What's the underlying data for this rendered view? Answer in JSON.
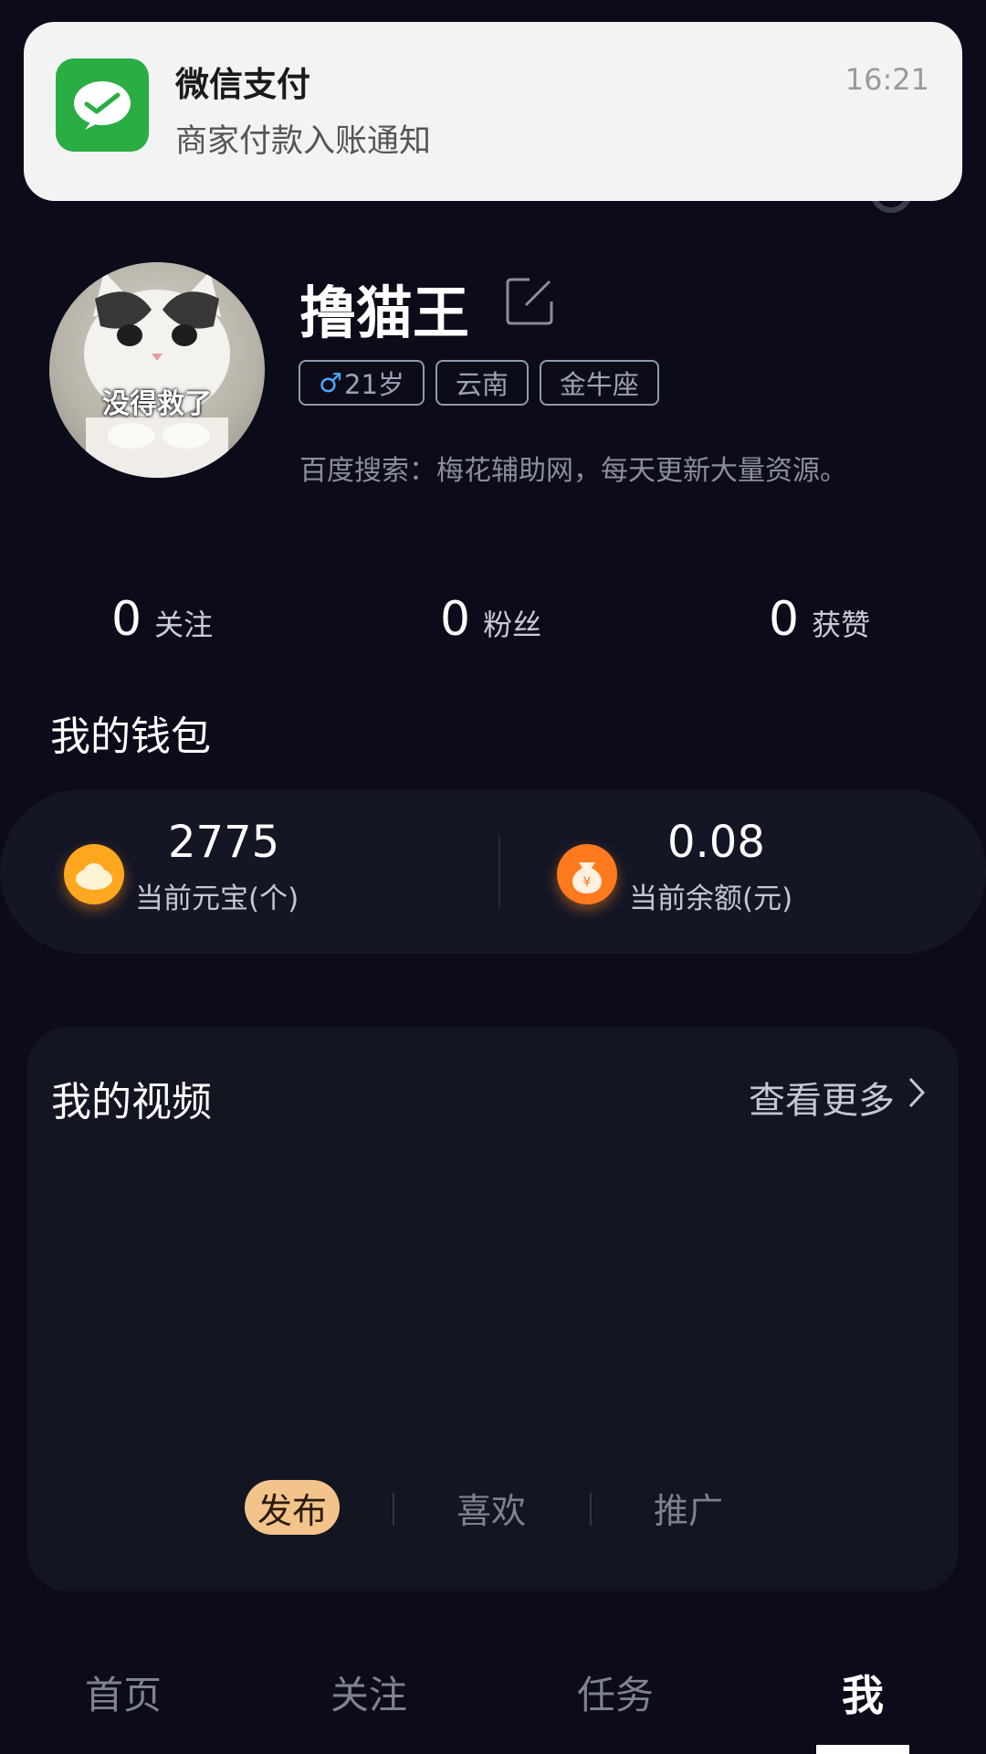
{
  "notification": {
    "app_name": "微信支付",
    "message": "商家付款入账通知",
    "time": "16:21",
    "icon": "wechat-pay-icon"
  },
  "profile": {
    "avatar_caption": "没得救了",
    "username": "撸猫王",
    "tags": {
      "gender_symbol": "♂",
      "age": "21岁",
      "region": "云南",
      "zodiac": "金牛座"
    },
    "signature": "百度搜索：梅花辅助网，每天更新大量资源。"
  },
  "stats": {
    "following": {
      "value": "0",
      "label": "关注"
    },
    "fans": {
      "value": "0",
      "label": "粉丝"
    },
    "likes": {
      "value": "0",
      "label": "获赞"
    }
  },
  "wallet": {
    "title": "我的钱包",
    "yuanbao": {
      "value": "2775",
      "label": "当前元宝(个)"
    },
    "balance": {
      "value": "0.08",
      "label": "当前余额(元)"
    }
  },
  "videos": {
    "title": "我的视频",
    "more": "查看更多",
    "tabs": [
      "发布",
      "喜欢",
      "推广"
    ],
    "active_tab": "发布"
  },
  "bottom_nav": {
    "items": [
      "首页",
      "关注",
      "任务",
      "我"
    ],
    "active": "我"
  },
  "colors": {
    "background": "#0c0b19",
    "card": "#141625",
    "accent_tab": "#f2c48c",
    "wechat_green": "#2aad43",
    "coin_orange": "#ffa81f"
  }
}
